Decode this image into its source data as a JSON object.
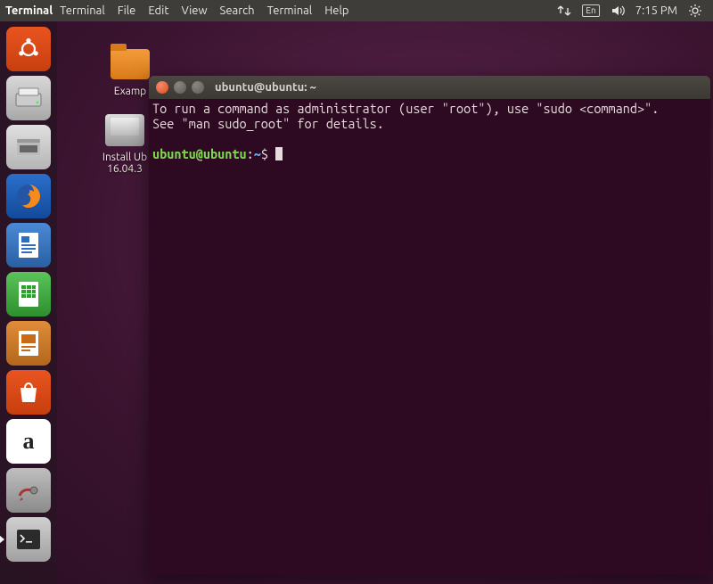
{
  "menubar": {
    "app_label": "Terminal",
    "items": [
      "Terminal",
      "File",
      "Edit",
      "View",
      "Search",
      "Terminal",
      "Help"
    ],
    "indicators": {
      "lang": "En",
      "time": "7:15 PM"
    }
  },
  "launcher": {
    "tiles": [
      {
        "name": "ubuntu-dash"
      },
      {
        "name": "drive"
      },
      {
        "name": "files"
      },
      {
        "name": "firefox"
      },
      {
        "name": "libreoffice-writer"
      },
      {
        "name": "libreoffice-calc"
      },
      {
        "name": "libreoffice-impress"
      },
      {
        "name": "ubuntu-software"
      },
      {
        "name": "amazon"
      },
      {
        "name": "system-settings"
      },
      {
        "name": "terminal"
      }
    ]
  },
  "desktop": {
    "icons": [
      {
        "label_line1": "Examp",
        "type": "folder"
      },
      {
        "label_line1": "Install Ub",
        "label_line2": "16.04.3",
        "type": "disk"
      }
    ]
  },
  "terminal": {
    "title": "ubuntu@ubuntu: ~",
    "line1": "To run a command as administrator (user \"root\"), use \"sudo <command>\".",
    "line2": "See \"man sudo_root\" for details.",
    "prompt_user": "ubuntu@ubuntu",
    "prompt_sep": ":",
    "prompt_path": "~",
    "prompt_end": "$ "
  }
}
